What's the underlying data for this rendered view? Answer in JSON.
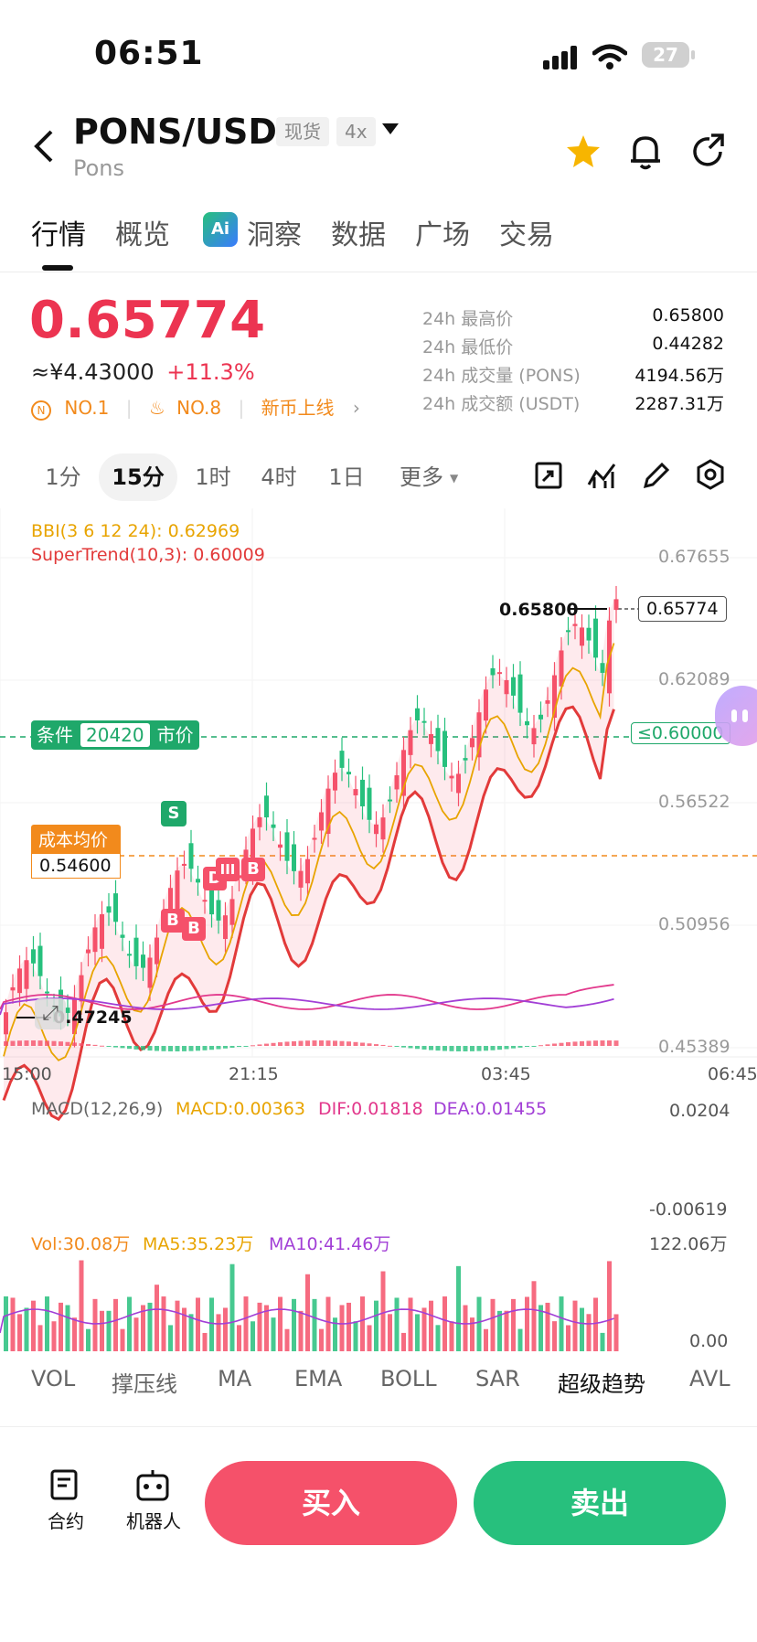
{
  "status_bar": {
    "time": "06:51",
    "battery": "27"
  },
  "header": {
    "pair": "PONS/USDT",
    "spot_tag": "现货",
    "leverage_tag": "4x",
    "name": "Pons"
  },
  "tabs": [
    "行情",
    "概览",
    "洞察",
    "数据",
    "广场",
    "交易"
  ],
  "ai_badge": "Ai",
  "price": {
    "last": "0.65774",
    "cny": "≈¥4.43000",
    "change": "+11.3%",
    "rank_no1": "NO.1",
    "rank_no8": "NO.8",
    "new_listing": "新币上线"
  },
  "stats": [
    {
      "label": "24h 最高价",
      "value": "0.65800"
    },
    {
      "label": "24h 最低价",
      "value": "0.44282"
    },
    {
      "label": "24h 成交量 (PONS)",
      "value": "4194.56万"
    },
    {
      "label": "24h 成交额 (USDT)",
      "value": "2287.31万"
    }
  ],
  "timeframes": [
    "1分",
    "15分",
    "1时",
    "4时",
    "1日",
    "更多"
  ],
  "active_timeframe": "15分",
  "colors": {
    "up": "#f5516a",
    "down": "#27c07d",
    "accent": "#f28a1c",
    "price_red": "#ec3451"
  },
  "chart": {
    "bbi_label": "BBI(3 6 12 24): 0.62969",
    "supertrend_label": "SuperTrend(10,3): 0.60009",
    "y_labels": [
      "0.67655",
      "0.62089",
      "0.56522",
      "0.50956",
      "0.45389"
    ],
    "x_labels": [
      "15:00",
      "21:15",
      "03:45",
      "06:45"
    ],
    "high_marker": "0.65800",
    "low_marker": "0.47245",
    "last_price_tag": "0.65774",
    "condition_label": "条件",
    "condition_qty": "20420",
    "condition_type": "市价",
    "condition_price": "≤0.60000",
    "cost_label": "成本均价",
    "cost_value": "0.54600",
    "signal_s": "S",
    "signal_b": "B",
    "signal_d": "D",
    "signal_iii": "III"
  },
  "macd": {
    "title": "MACD(12,26,9)",
    "macd": "MACD:0.00363",
    "dif": "DIF:0.01818",
    "dea": "DEA:0.01455",
    "y_top": "0.0204",
    "y_bottom": "-0.00619"
  },
  "volume": {
    "vol": "Vol:30.08万",
    "ma5": "MA5:35.23万",
    "ma10": "MA10:41.46万",
    "y_top": "122.06万",
    "y_bottom": "0.00"
  },
  "indicator_tabs": [
    "VOL",
    "撑压线",
    "MA",
    "EMA",
    "BOLL",
    "SAR",
    "超级趋势",
    "AVL"
  ],
  "bottom": {
    "contract": "合约",
    "bot": "机器人",
    "buy": "买入",
    "sell": "卖出"
  }
}
